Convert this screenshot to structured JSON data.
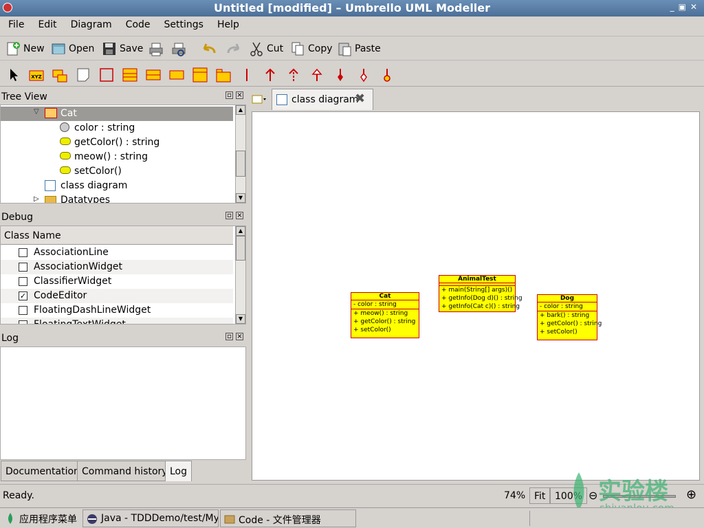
{
  "window": {
    "title": "Untitled [modified] – Umbrello UML Modeller"
  },
  "menu": [
    "File",
    "Edit",
    "Diagram",
    "Code",
    "Settings",
    "Help"
  ],
  "toolbar": {
    "new": "New",
    "open": "Open",
    "save": "Save",
    "cut": "Cut",
    "copy": "Copy",
    "paste": "Paste"
  },
  "tree_view": {
    "title": "Tree View",
    "items": [
      {
        "label": "Cat",
        "icon": "class-icon",
        "selected": true
      },
      {
        "label": "color : string",
        "icon": "attribute-icon"
      },
      {
        "label": "getColor() : string",
        "icon": "operation-icon"
      },
      {
        "label": "meow() : string",
        "icon": "operation-icon"
      },
      {
        "label": "setColor()",
        "icon": "operation-icon"
      },
      {
        "label": "class diagram",
        "icon": "diagram-icon"
      },
      {
        "label": "Datatypes",
        "icon": "folder-icon"
      }
    ]
  },
  "debug": {
    "title": "Debug",
    "column": "Class Name",
    "items": [
      {
        "label": "AssociationLine",
        "checked": false
      },
      {
        "label": "AssociationWidget",
        "checked": false
      },
      {
        "label": "ClassifierWidget",
        "checked": false
      },
      {
        "label": "CodeEditor",
        "checked": true
      },
      {
        "label": "FloatingDashLineWidget",
        "checked": false
      },
      {
        "label": "FloatingTextWidget",
        "checked": false
      }
    ]
  },
  "log": {
    "title": "Log"
  },
  "bottom_tabs": [
    "Documentation",
    "Command history",
    "Log"
  ],
  "diagram_tab": {
    "label": "class diagram"
  },
  "uml_classes": [
    {
      "name": "Cat",
      "attributes": [
        "- color : string"
      ],
      "operations": [
        "+ meow() : string",
        "+ getColor() : string",
        "+ setColor()"
      ]
    },
    {
      "name": "AnimalTest",
      "attributes": [],
      "operations": [
        "+ main(String[] args)()",
        "+ getInfo(Dog d)() : string",
        "+ getInfo(Cat c)() : string"
      ]
    },
    {
      "name": "Dog",
      "attributes": [
        "- color : string"
      ],
      "operations": [
        "+ bark() : string",
        "+ getColor() : string",
        "+ setColor()"
      ]
    }
  ],
  "status": {
    "text": "Ready.",
    "zoom": "74%",
    "fit": "Fit",
    "zoom_button": "100%"
  },
  "taskbar": [
    {
      "label": "应用程序菜单",
      "icon": "app-menu-icon"
    },
    {
      "label": "Java - TDDDemo/test/My...",
      "icon": "eclipse-icon"
    },
    {
      "label": "Code - 文件管理器",
      "icon": "folder-icon"
    }
  ],
  "watermark": {
    "cn": "实验楼",
    "url": "shiyanlou.com"
  },
  "colors": {
    "class_fill": "#ffff00",
    "class_border": "#cc0000",
    "titlebar": "#5a7fa8",
    "selection": "#9c9a97"
  }
}
